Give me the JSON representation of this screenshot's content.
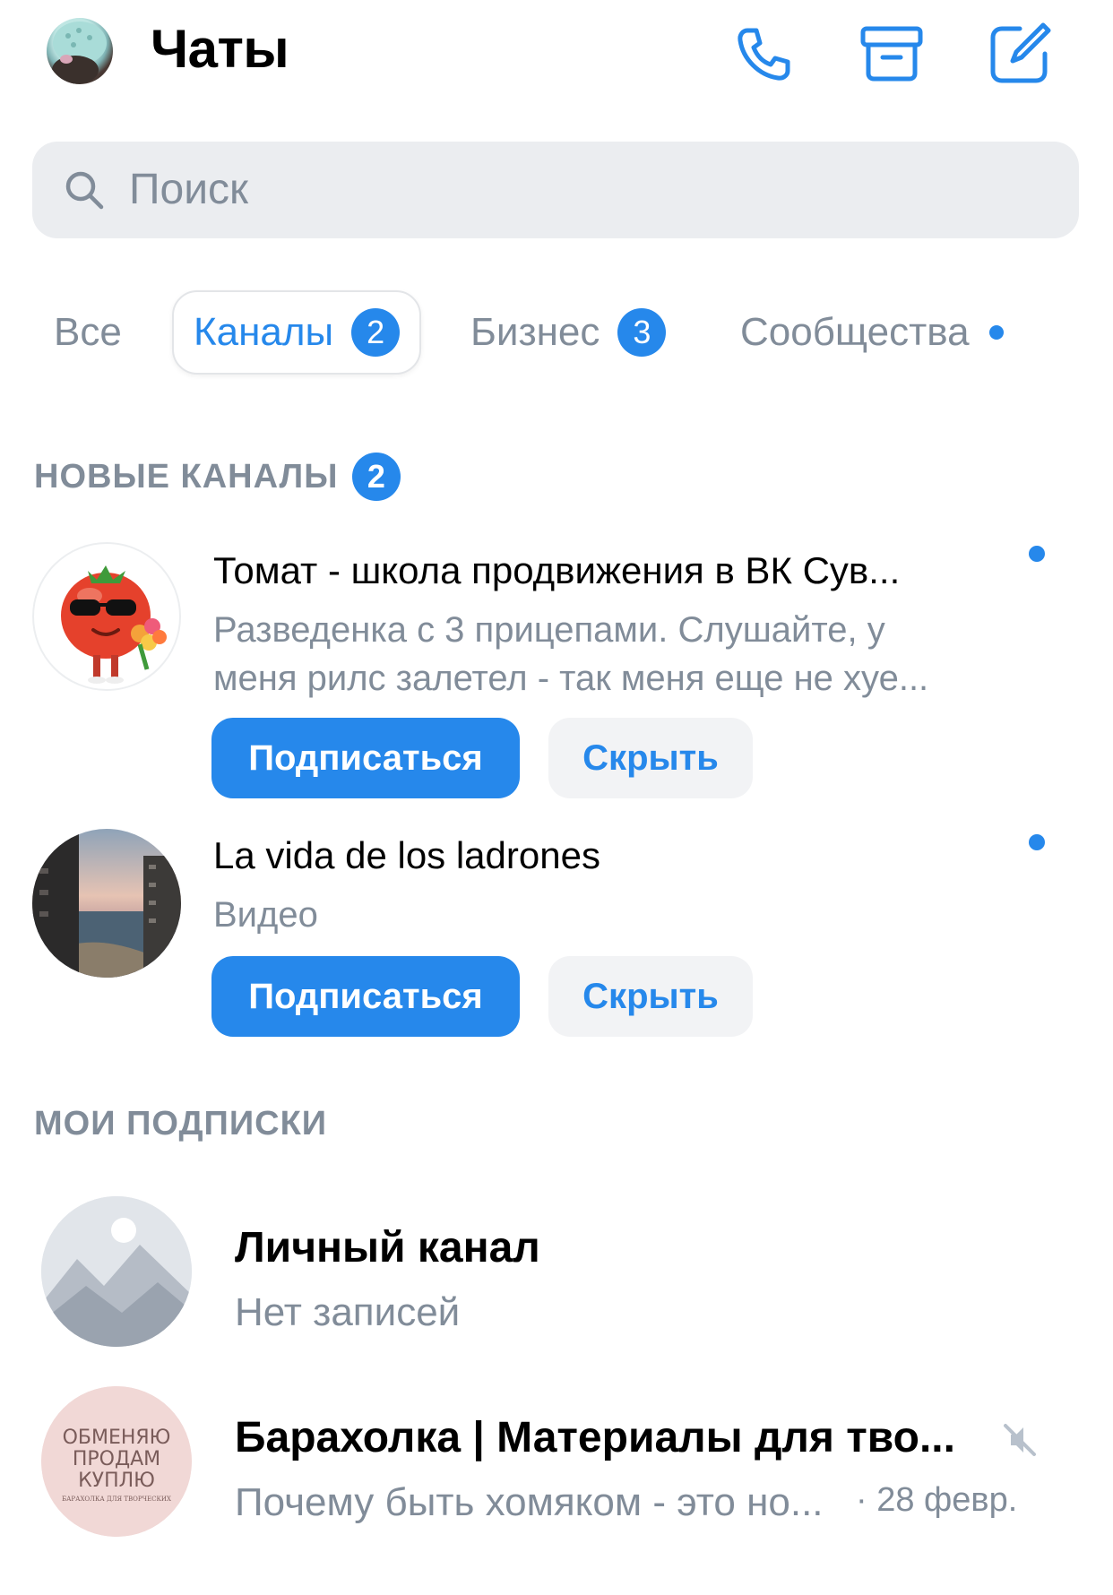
{
  "header": {
    "title": "Чаты",
    "icons": [
      "phone-icon",
      "archive-icon",
      "compose-icon"
    ]
  },
  "search": {
    "placeholder": "Поиск"
  },
  "tabs": [
    {
      "label": "Все",
      "active": false
    },
    {
      "label": "Каналы",
      "badge": "2",
      "active": true
    },
    {
      "label": "Бизнес",
      "badge": "3",
      "active": false
    },
    {
      "label": "Сообщества",
      "dot": true,
      "active": false
    }
  ],
  "new_channels": {
    "title": "НОВЫЕ КАНАЛЫ",
    "badge": "2",
    "items": [
      {
        "name": "Томат - школа продвижения в ВК Сув...",
        "line1": "Разведенка с 3 прицепами. Слушайте, у",
        "line2": "меня рилс залетел - так меня еще не хуе...",
        "subscribe_label": "Подписаться",
        "hide_label": "Скрыть",
        "unread": true
      },
      {
        "name": "La vida de los ladrones",
        "line1": "Видео",
        "subscribe_label": "Подписаться",
        "hide_label": "Скрыть",
        "unread": true
      }
    ]
  },
  "my_subscriptions": {
    "title": "МОИ ПОДПИСКИ",
    "items": [
      {
        "name": "Личный канал",
        "subtitle": "Нет записей"
      },
      {
        "name": "Барахолка | Материалы для тво...",
        "subtitle": "Почему быть хомяком - это но...",
        "date": "· 28 февр.",
        "muted": true,
        "avatar_text": [
          "ОБМЕНЯЮ",
          "ПРОДАМ",
          "КУПЛЮ",
          "БАРАХОЛКА ДЛЯ ТВОРЧЕСКИХ"
        ]
      }
    ]
  },
  "colors": {
    "accent": "#2688eb",
    "secondary_text": "#818c99",
    "search_bg": "#ebedf0"
  }
}
